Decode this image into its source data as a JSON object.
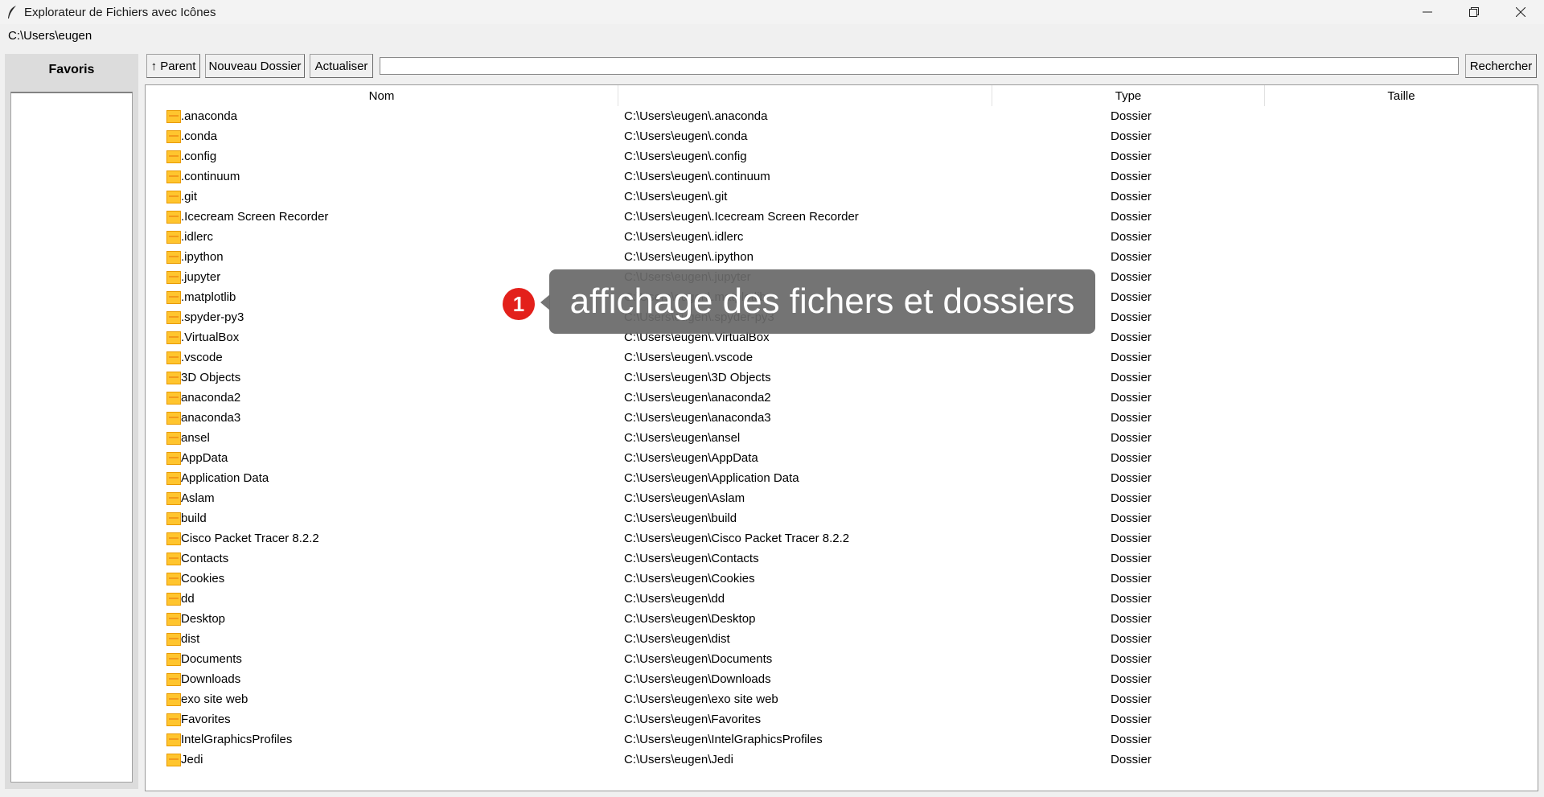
{
  "window": {
    "title": "Explorateur de Fichiers avec Icônes",
    "icon": "feather-icon",
    "controls": [
      "minimize-icon",
      "restore-icon",
      "close-icon"
    ]
  },
  "current_path": "C:\\Users\\eugen",
  "sidebar": {
    "title": "Favoris",
    "items": []
  },
  "toolbar": {
    "parent_label": "↑ Parent",
    "new_folder_label": "Nouveau Dossier",
    "refresh_label": "Actualiser",
    "search_value": "",
    "search_label": "Rechercher"
  },
  "table": {
    "columns": [
      "Nom",
      "",
      "Type",
      "Taille"
    ],
    "rows": [
      {
        "name": ".anaconda",
        "path": "C:\\Users\\eugen\\.anaconda",
        "type": "Dossier",
        "size": ""
      },
      {
        "name": ".conda",
        "path": "C:\\Users\\eugen\\.conda",
        "type": "Dossier",
        "size": ""
      },
      {
        "name": ".config",
        "path": "C:\\Users\\eugen\\.config",
        "type": "Dossier",
        "size": ""
      },
      {
        "name": ".continuum",
        "path": "C:\\Users\\eugen\\.continuum",
        "type": "Dossier",
        "size": ""
      },
      {
        "name": ".git",
        "path": "C:\\Users\\eugen\\.git",
        "type": "Dossier",
        "size": ""
      },
      {
        "name": ".Icecream Screen Recorder",
        "path": "C:\\Users\\eugen\\.Icecream Screen Recorder",
        "type": "Dossier",
        "size": ""
      },
      {
        "name": ".idlerc",
        "path": "C:\\Users\\eugen\\.idlerc",
        "type": "Dossier",
        "size": ""
      },
      {
        "name": ".ipython",
        "path": "C:\\Users\\eugen\\.ipython",
        "type": "Dossier",
        "size": ""
      },
      {
        "name": ".jupyter",
        "path": "C:\\Users\\eugen\\.jupyter",
        "type": "Dossier",
        "size": ""
      },
      {
        "name": ".matplotlib",
        "path": "C:\\Users\\eugen\\.matplotlib",
        "type": "Dossier",
        "size": ""
      },
      {
        "name": ".spyder-py3",
        "path": "C:\\Users\\eugen\\.spyder-py3",
        "type": "Dossier",
        "size": ""
      },
      {
        "name": ".VirtualBox",
        "path": "C:\\Users\\eugen\\.VirtualBox",
        "type": "Dossier",
        "size": ""
      },
      {
        "name": ".vscode",
        "path": "C:\\Users\\eugen\\.vscode",
        "type": "Dossier",
        "size": ""
      },
      {
        "name": "3D Objects",
        "path": "C:\\Users\\eugen\\3D Objects",
        "type": "Dossier",
        "size": ""
      },
      {
        "name": "anaconda2",
        "path": "C:\\Users\\eugen\\anaconda2",
        "type": "Dossier",
        "size": ""
      },
      {
        "name": "anaconda3",
        "path": "C:\\Users\\eugen\\anaconda3",
        "type": "Dossier",
        "size": ""
      },
      {
        "name": "ansel",
        "path": "C:\\Users\\eugen\\ansel",
        "type": "Dossier",
        "size": ""
      },
      {
        "name": "AppData",
        "path": "C:\\Users\\eugen\\AppData",
        "type": "Dossier",
        "size": ""
      },
      {
        "name": "Application Data",
        "path": "C:\\Users\\eugen\\Application Data",
        "type": "Dossier",
        "size": ""
      },
      {
        "name": "Aslam",
        "path": "C:\\Users\\eugen\\Aslam",
        "type": "Dossier",
        "size": ""
      },
      {
        "name": "build",
        "path": "C:\\Users\\eugen\\build",
        "type": "Dossier",
        "size": ""
      },
      {
        "name": "Cisco Packet Tracer 8.2.2",
        "path": "C:\\Users\\eugen\\Cisco Packet Tracer 8.2.2",
        "type": "Dossier",
        "size": ""
      },
      {
        "name": "Contacts",
        "path": "C:\\Users\\eugen\\Contacts",
        "type": "Dossier",
        "size": ""
      },
      {
        "name": "Cookies",
        "path": "C:\\Users\\eugen\\Cookies",
        "type": "Dossier",
        "size": ""
      },
      {
        "name": "dd",
        "path": "C:\\Users\\eugen\\dd",
        "type": "Dossier",
        "size": ""
      },
      {
        "name": "Desktop",
        "path": "C:\\Users\\eugen\\Desktop",
        "type": "Dossier",
        "size": ""
      },
      {
        "name": "dist",
        "path": "C:\\Users\\eugen\\dist",
        "type": "Dossier",
        "size": ""
      },
      {
        "name": "Documents",
        "path": "C:\\Users\\eugen\\Documents",
        "type": "Dossier",
        "size": ""
      },
      {
        "name": "Downloads",
        "path": "C:\\Users\\eugen\\Downloads",
        "type": "Dossier",
        "size": ""
      },
      {
        "name": "exo site web",
        "path": "C:\\Users\\eugen\\exo site web",
        "type": "Dossier",
        "size": ""
      },
      {
        "name": "Favorites",
        "path": "C:\\Users\\eugen\\Favorites",
        "type": "Dossier",
        "size": ""
      },
      {
        "name": "IntelGraphicsProfiles",
        "path": "C:\\Users\\eugen\\IntelGraphicsProfiles",
        "type": "Dossier",
        "size": ""
      },
      {
        "name": "Jedi",
        "path": "C:\\Users\\eugen\\Jedi",
        "type": "Dossier",
        "size": ""
      }
    ]
  },
  "annotation": {
    "number": "1",
    "text": "affichage des fichers et dossiers"
  },
  "colors": {
    "folder_fill": "#ffc52e",
    "folder_border": "#e89a00",
    "badge": "#e3201b",
    "callout_bg": "#696969"
  }
}
